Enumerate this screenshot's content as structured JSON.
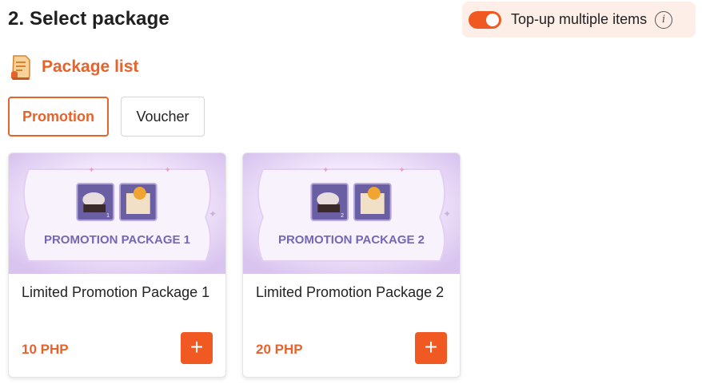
{
  "section": {
    "title": "2. Select package"
  },
  "multi_topup": {
    "label": "Top-up multiple items",
    "enabled": true,
    "info_icon": "info-icon"
  },
  "package_list": {
    "title": "Package list",
    "icon": "receipt-icon"
  },
  "tabs": [
    {
      "label": "Promotion",
      "active": true
    },
    {
      "label": "Voucher",
      "active": false
    }
  ],
  "packages": [
    {
      "banner_text": "PROMOTION PACKAGE 1",
      "item_count": "1",
      "name": "Limited Promotion Package 1",
      "price": "10 PHP",
      "add_icon": "+"
    },
    {
      "banner_text": "PROMOTION PACKAGE 2",
      "item_count": "2",
      "name": "Limited Promotion Package 2",
      "price": "20 PHP",
      "add_icon": "+"
    }
  ],
  "colors": {
    "accent": "#f05a22",
    "accent_text": "#e8622b",
    "toggle_bg": "#fdeee7",
    "banner": "#e9dcf6"
  }
}
